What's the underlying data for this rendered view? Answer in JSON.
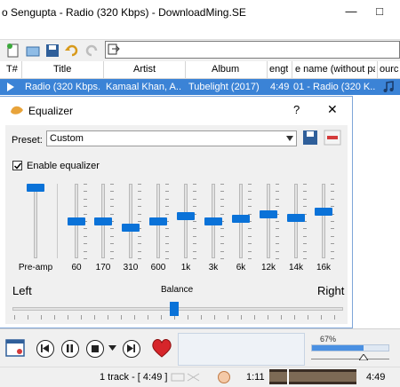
{
  "window": {
    "title": "o Sengupta - Radio (320 Kbps) - DownloadMing.SE",
    "min": "—",
    "max": "□"
  },
  "playlist": {
    "columns": [
      "T#",
      "Title",
      "Artist",
      "Album",
      "engt",
      "e name (without pa",
      "ourc"
    ],
    "row": {
      "title": "Radio (320 Kbps...",
      "artist": "Kamaal Khan, A...",
      "album": "Tubelight (2017)",
      "length": "4:49",
      "filename": "01 - Radio (320 K..."
    }
  },
  "equalizer": {
    "title": "Equalizer",
    "help": "?",
    "close": "✕",
    "preset_label": "Preset:",
    "preset_value": "Custom",
    "enable_label": "Enable equalizer",
    "enabled": true,
    "bands": [
      {
        "label": "Pre-amp",
        "level": 0.95
      },
      {
        "label": "60",
        "level": 0.5
      },
      {
        "label": "170",
        "level": 0.5
      },
      {
        "label": "310",
        "level": 0.42
      },
      {
        "label": "600",
        "level": 0.5
      },
      {
        "label": "1k",
        "level": 0.57
      },
      {
        "label": "3k",
        "level": 0.5
      },
      {
        "label": "6k",
        "level": 0.54
      },
      {
        "label": "12k",
        "level": 0.6
      },
      {
        "label": "14k",
        "level": 0.55
      },
      {
        "label": "16k",
        "level": 0.63
      }
    ],
    "balance_label": "Balance",
    "left_label": "Left",
    "right_label": "Right",
    "balance_level": 0.49
  },
  "controls": {
    "volume_pct": "67%",
    "volume_level": 0.67
  },
  "status": {
    "track_info": "1 track - [ 4:49 ]",
    "elapsed": "1:11",
    "total": "4:49"
  },
  "colors": {
    "accent": "#0a72d8",
    "selection": "#3b83d6",
    "heart": "#d6252a"
  }
}
